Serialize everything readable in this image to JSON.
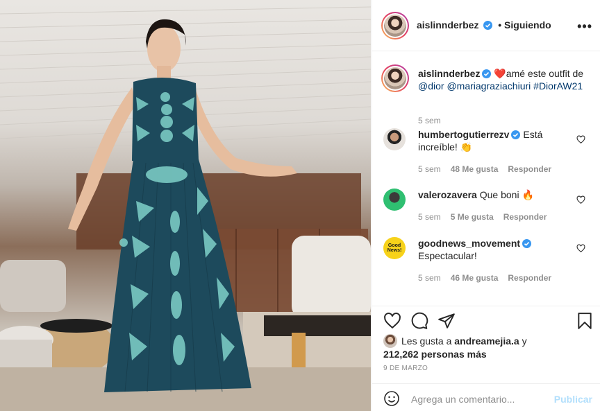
{
  "post": {
    "author": "aislinnderbez",
    "follow_status": "• Siguiendo",
    "more_label": "•••"
  },
  "caption": {
    "author": "aislinnderbez",
    "heart_emoji": "❤️",
    "text": "amé este outfit de",
    "mentions": [
      "@dior",
      "@mariagraziachiuri",
      "#DiorAW21"
    ],
    "age": "5 sem"
  },
  "comments": [
    {
      "user": "humbertogutierrezv",
      "verified": true,
      "text": "Está increíble!",
      "emoji": "👏",
      "age": "5 sem",
      "likes": "48 Me gusta",
      "reply": "Responder"
    },
    {
      "user": "valerozavera",
      "verified": false,
      "text": "Que boni",
      "emoji": "🔥",
      "age": "5 sem",
      "likes": "5 Me gusta",
      "reply": "Responder"
    },
    {
      "user": "goodnews_movement",
      "verified": true,
      "text": "Espectacular!",
      "emoji": "",
      "age": "5 sem",
      "likes": "46 Me gusta",
      "reply": "Responder",
      "avatar_text": "Good News!"
    }
  ],
  "likes": {
    "prefix": "Les gusta a",
    "user": "andreamejia.a",
    "suffix": "y",
    "count": "212,262 personas más"
  },
  "date": "9 DE MARZO",
  "add_comment": {
    "placeholder": "Agrega un comentario...",
    "publish": "Publicar"
  },
  "colors": {
    "verified": "#3897f0",
    "link": "#00376b",
    "muted": "#8e8e8e",
    "publish_disabled": "#b2dffc",
    "dress": "#1d4a5c",
    "dress_pattern": "#7fd1c9"
  }
}
